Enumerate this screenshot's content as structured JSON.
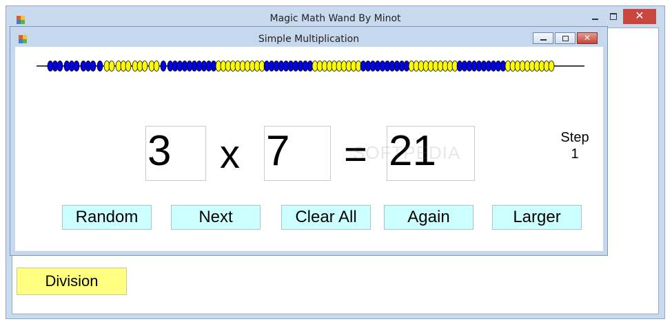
{
  "window": {
    "title": "Magic Math Wand By Minot",
    "close_glyph": "✕"
  },
  "child": {
    "title": "Simple Multiplication",
    "close_glyph": "✕"
  },
  "abacus": {
    "bead_colors": {
      "blue": "#0000e0",
      "yellow": "#ffff00"
    },
    "groups": [
      {
        "color": "blue",
        "count": 3
      },
      {
        "color": "blue",
        "count": 3
      },
      {
        "color": "blue",
        "count": 3
      },
      {
        "color": "blue",
        "count": 1
      },
      {
        "color": "yellow",
        "count": 2
      },
      {
        "color": "yellow",
        "count": 3
      },
      {
        "color": "yellow",
        "count": 3
      },
      {
        "color": "yellow",
        "count": 2
      },
      {
        "color": "blue",
        "count": 1
      },
      {
        "color": "blue",
        "count": 10
      },
      {
        "color": "yellow",
        "count": 10
      },
      {
        "color": "blue",
        "count": 10
      },
      {
        "color": "yellow",
        "count": 10
      },
      {
        "color": "blue",
        "count": 10
      },
      {
        "color": "yellow",
        "count": 10
      },
      {
        "color": "blue",
        "count": 10
      },
      {
        "color": "yellow",
        "count": 10
      }
    ]
  },
  "equation": {
    "a": "3",
    "times": "x",
    "b": "7",
    "equals": "=",
    "result": "21"
  },
  "step": {
    "label": "Step",
    "value": "1"
  },
  "buttons": {
    "random": "Random",
    "next": "Next",
    "clear_all": "Clear All",
    "again": "Again",
    "larger": "Larger"
  },
  "division": "Division",
  "watermark": "SOFTPEDIA"
}
